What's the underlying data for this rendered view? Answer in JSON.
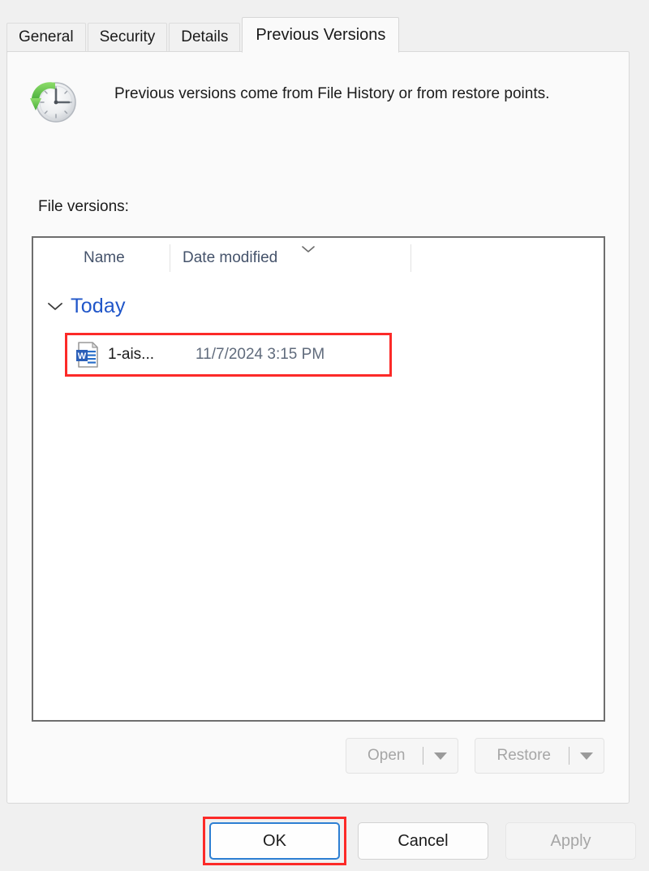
{
  "dialog": {
    "tabs": [
      {
        "label": "General",
        "selected": false
      },
      {
        "label": "Security",
        "selected": false
      },
      {
        "label": "Details",
        "selected": false
      },
      {
        "label": "Previous Versions",
        "selected": true
      }
    ],
    "header": {
      "icon": "restore-clock-icon",
      "description": "Previous versions come from File History or from restore points."
    },
    "file_versions": {
      "label": "File versions:",
      "columns": [
        "Name",
        "Date modified",
        ""
      ],
      "sort_indicator_column": "Date modified",
      "sort_indicator_icon": "chevron-up-sort-icon",
      "groups": [
        {
          "label": "Today",
          "expanded": true,
          "chevron_icon": "chevron-down-icon",
          "rows": [
            {
              "icon": "word-document-icon",
              "name": "1-ais...",
              "date_modified": "11/7/2024 3:15 PM",
              "highlighted": true
            }
          ]
        }
      ]
    },
    "split_buttons": [
      {
        "label": "Open",
        "enabled": false,
        "arrow_icon": "caret-down-icon"
      },
      {
        "label": "Restore",
        "enabled": false,
        "arrow_icon": "caret-down-icon"
      }
    ],
    "footer_buttons": {
      "ok": "OK",
      "cancel": "Cancel",
      "apply": "Apply"
    }
  },
  "colors": {
    "annotation": "#fc2a28",
    "focus": "#2d7fd3",
    "group_label": "#2056c9",
    "header_text": "#45536b",
    "disabled_text": "#a6a6a6"
  }
}
